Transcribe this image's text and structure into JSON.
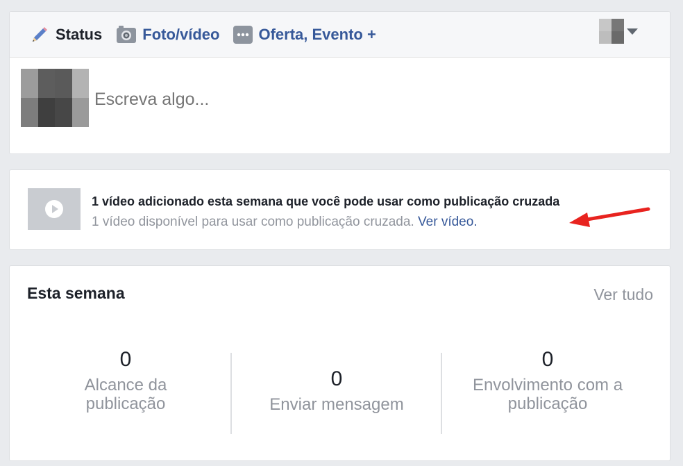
{
  "composer": {
    "tabs": [
      {
        "label": "Status",
        "icon": "pencil-icon"
      },
      {
        "label": "Foto/vídeo",
        "icon": "camera-icon"
      },
      {
        "label": "Oferta, Evento +",
        "icon": "more-icon"
      }
    ],
    "placeholder": "Escreva algo..."
  },
  "notice": {
    "title": "1 vídeo adicionado esta semana que você pode usar como publicação cruzada",
    "subtitle": "1 vídeo disponível para usar como publicação cruzada.",
    "link": "Ver vídeo."
  },
  "week": {
    "title": "Esta semana",
    "see_all": "Ver tudo",
    "stats": [
      {
        "value": "0",
        "label_line1": "Alcance da",
        "label_line2": "publicação"
      },
      {
        "value": "0",
        "label_line1": "Enviar mensagem",
        "label_line2": ""
      },
      {
        "value": "0",
        "label_line1": "Envolvimento com a",
        "label_line2": "publicação"
      }
    ]
  },
  "colors": {
    "background": "#e9ebee",
    "link": "#365899",
    "muted_text": "#90949c",
    "annotation_arrow": "#e8231f"
  }
}
